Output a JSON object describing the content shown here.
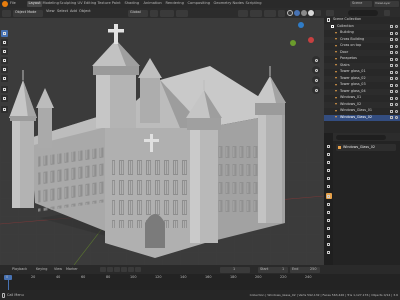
{
  "workspaces": [
    "Layout",
    "Modeling",
    "Sculpting",
    "UV Editing",
    "Texture Paint",
    "Shading",
    "Animation",
    "Rendering",
    "Compositing",
    "Geometry Nodes",
    "Scripting"
  ],
  "active_workspace": "Layout",
  "scene": {
    "label": "Scene",
    "view_layer": "ViewLayer"
  },
  "viewport_header": {
    "mode": "Object Mode",
    "view": "View",
    "select": "Select",
    "add": "Add",
    "object": "Object",
    "transform": "Global",
    "options": "Options"
  },
  "outliner": {
    "title": "Scene Collection",
    "collection": "Collection",
    "items": [
      "Building",
      "Cross Building",
      "Cross on top",
      "Door",
      "Parapetas",
      "Stairs",
      "Tower glass_01",
      "Tower glass_02",
      "Tower glass_03",
      "Tower glass_04",
      "Windows_01",
      "Windows_02",
      "Windows_Glass_01",
      "Windows_Glass_02"
    ]
  },
  "properties": {
    "object_name": "Windows_Glass_02"
  },
  "timeline": {
    "menus": [
      "Playback",
      "Keying",
      "View",
      "Marker"
    ],
    "current_frame": "1",
    "start_label": "Start",
    "start": "1",
    "end_label": "End",
    "end": "250",
    "ticks": [
      "0",
      "20",
      "40",
      "60",
      "80",
      "100",
      "120",
      "140",
      "160",
      "180",
      "200",
      "220",
      "240"
    ]
  },
  "statusbar": {
    "left": "Call Menu",
    "right": "Collection | Windows_Glass_02 | Verts 592,132 | Faces 563,426 | Tris 1,127,176 | Objects 0/14 | 3.6"
  },
  "colors": {
    "accent": "#4772b3",
    "collection_orange": "#e7a14a",
    "selected_row": "#334d80"
  }
}
